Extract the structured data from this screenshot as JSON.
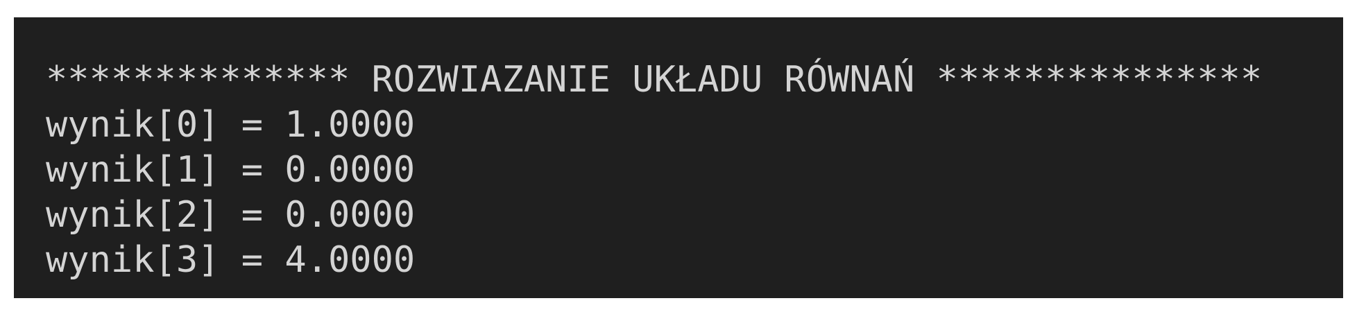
{
  "terminal": {
    "lines": [
      "************** ROZWIAZANIE UKŁADU RÓWNAŃ ***************",
      "wynik[0] = 1.0000",
      "wynik[1] = 0.0000",
      "wynik[2] = 0.0000",
      "wynik[3] = 4.0000"
    ]
  },
  "colors": {
    "terminal_background": "#1f1f1f",
    "terminal_text": "#d4d4d4",
    "page_background": "#ffffff"
  }
}
